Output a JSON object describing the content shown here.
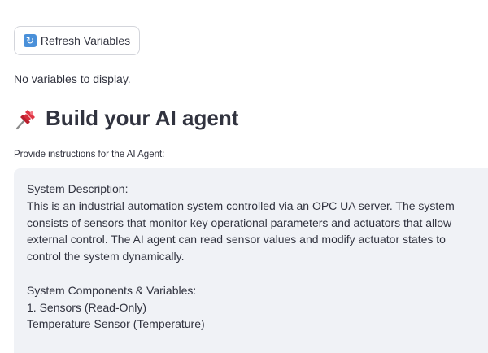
{
  "refresh_button": {
    "icon": "refresh-icon",
    "label": "Refresh Variables"
  },
  "variables_status": "No variables to display.",
  "section": {
    "icon": "pushpin-icon",
    "title": "Build your AI agent"
  },
  "instructions": {
    "label": "Provide instructions for the AI Agent:",
    "lines": {
      "l1": "System Description:",
      "l2": "This is an industrial automation system controlled via an OPC UA server. The system consists of sensors that monitor key operational parameters and actuators that allow external control. The AI agent can read sensor values and modify actuator states to control the system dynamically.",
      "l3": "System Components & Variables:",
      "l4": "1. Sensors (Read-Only)",
      "l5": "Temperature Sensor (Temperature)"
    }
  },
  "colors": {
    "text": "#31333f",
    "input_background": "#f0f2f6",
    "button_border": "#d3d5db",
    "pin_red": "#d62b3a"
  }
}
